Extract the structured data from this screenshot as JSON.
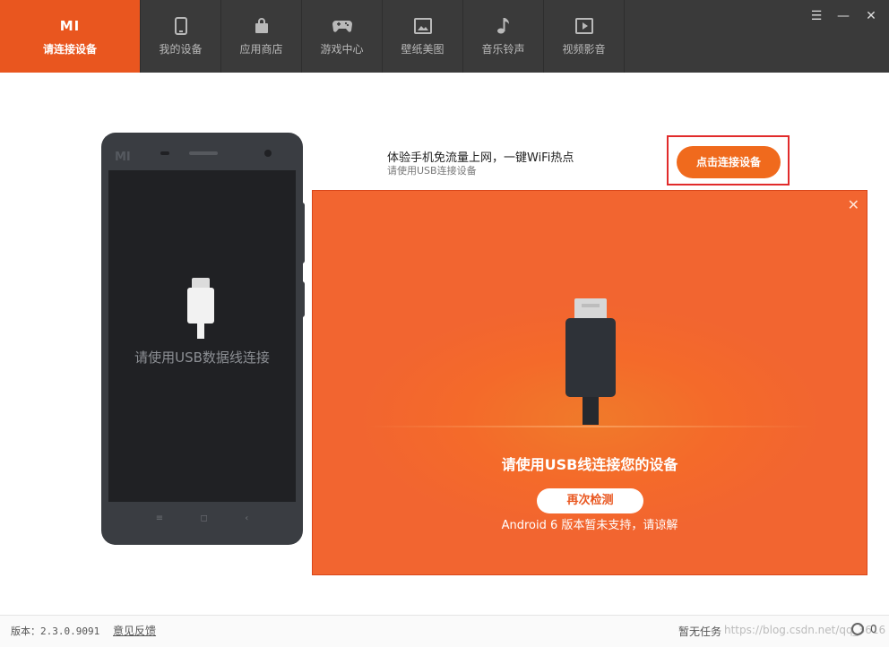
{
  "nav": {
    "logo": "MI",
    "items": [
      {
        "label": "请连接设备",
        "icon": "mi-logo-icon"
      },
      {
        "label": "我的设备",
        "icon": "phone-icon"
      },
      {
        "label": "应用商店",
        "icon": "shopping-bag-icon"
      },
      {
        "label": "游戏中心",
        "icon": "gamepad-icon"
      },
      {
        "label": "壁纸美图",
        "icon": "picture-icon"
      },
      {
        "label": "音乐铃声",
        "icon": "music-note-icon"
      },
      {
        "label": "视频影音",
        "icon": "video-play-icon"
      }
    ]
  },
  "window": {
    "menu_icon": "☰",
    "minimize_icon": "—",
    "close_icon": "✕"
  },
  "phone": {
    "logo": "MI",
    "screen_text": "请使用USB数据线连接",
    "keys": [
      "≡",
      "◻",
      "‹"
    ]
  },
  "promo": {
    "title": "体验手机免流量上网，一键WiFi热点",
    "subtitle": "请使用USB连接设备",
    "button": "点击连接设备"
  },
  "modal": {
    "close": "✕",
    "message": "请使用USB线连接您的设备",
    "retry_button": "再次检测",
    "note": "Android 6 版本暂未支持，请谅解"
  },
  "status": {
    "version": "版本：2.3.0.9091",
    "feedback": "意见反馈",
    "task": "暂无任务",
    "watermark": "https://blog.csdn.net/qq_3616",
    "count": "0"
  },
  "colors": {
    "accent": "#e9561f",
    "modal": "#f46a2a",
    "topbar": "#3a3a3a",
    "highlight": "#e12b2b"
  }
}
